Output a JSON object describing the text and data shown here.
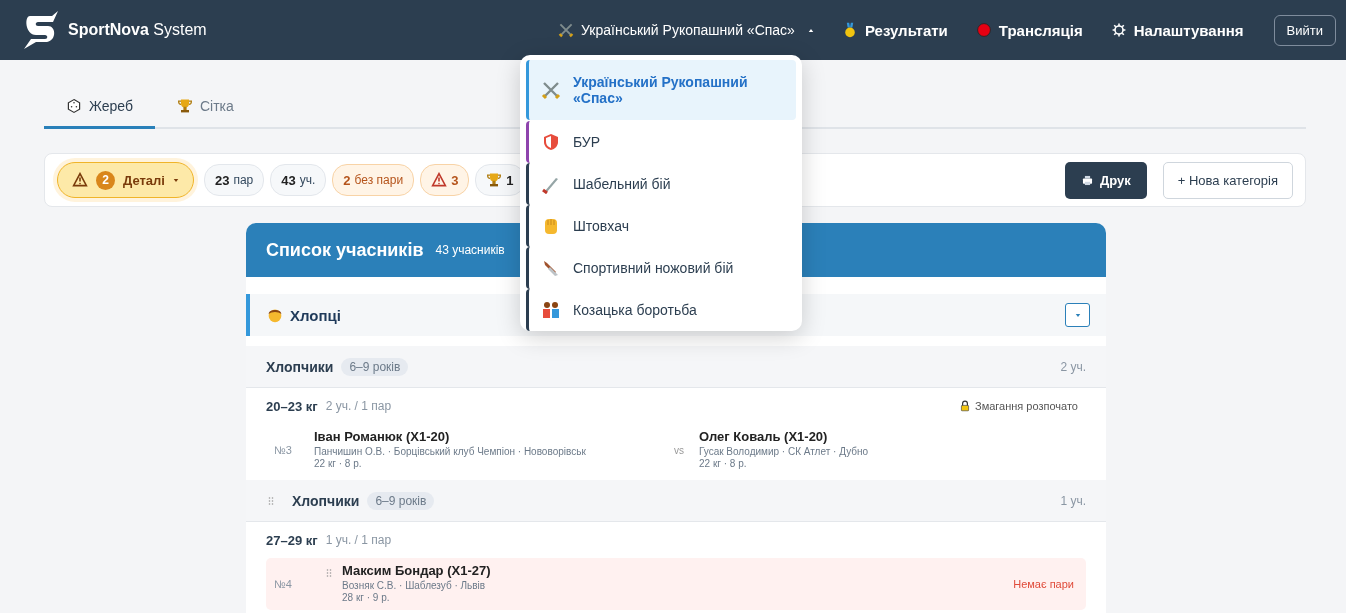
{
  "header": {
    "logo_text": "SportNova",
    "logo_sub": "System",
    "discipline": {
      "label": "Український Рукопашний «Спас»",
      "expanded": true
    },
    "nav": [
      {
        "kind": "medal",
        "label": "Результати"
      },
      {
        "kind": "live",
        "label": "Трансляція"
      },
      {
        "kind": "gear",
        "label": "Налаштування"
      }
    ],
    "logout": "Вийти"
  },
  "discipline_menu": [
    {
      "kind": "swords",
      "label": "Український Рукопашний «Спас»",
      "selected": true,
      "color": "#3498db"
    },
    {
      "kind": "shield",
      "label": "БУР",
      "selected": false,
      "color": "#8e44ad"
    },
    {
      "kind": "saber",
      "label": "Шабельний бій",
      "selected": false,
      "color": "#2c3e50"
    },
    {
      "kind": "fist",
      "label": "Штовхач",
      "selected": false,
      "color": "#2c3e50"
    },
    {
      "kind": "knife",
      "label": "Спортивний ножовий бій",
      "selected": false,
      "color": "#2c3e50"
    },
    {
      "kind": "wrestlers",
      "label": "Козацька боротьба",
      "selected": false,
      "color": "#2c3e50"
    }
  ],
  "tabs": [
    {
      "kind": "dice",
      "label": "Жереб",
      "selected": true
    },
    {
      "kind": "trophy",
      "label": "Сітка",
      "selected": false
    }
  ],
  "toolbar": {
    "details": {
      "count": "2",
      "label": "Деталі"
    },
    "chips": [
      {
        "kind": "plain",
        "value": "23",
        "label": "пар"
      },
      {
        "kind": "plain",
        "value": "43",
        "label": "уч."
      },
      {
        "kind": "orange",
        "value": "2",
        "label": "без пари"
      },
      {
        "kind": "warning",
        "value": "3"
      },
      {
        "kind": "trophy",
        "value": "1"
      }
    ],
    "print": "Друк",
    "new_category": "+ Нова категорія"
  },
  "list": {
    "title": "Список учасників",
    "subtitle": "43 учасників",
    "group": {
      "label": "Хлопці",
      "expanded": true
    },
    "sections": [
      {
        "title": "Хлопчики",
        "age": "6–9 років",
        "count": "2 уч.",
        "draggable": false,
        "weights": [
          {
            "weight": "20–23 кг",
            "meta": "2 уч. / 1 пар",
            "status": "Змагання розпочато",
            "pairs": [
              {
                "number": "№3",
                "unpaired": false,
                "draggable": false,
                "fighters": [
                  {
                    "name": "Іван Романюк (Х1-20)",
                    "info": "Панчишин О.В. · Борцівський клуб Чемпіон · Нововорівськ",
                    "stats": "22 кг · 8 р."
                  },
                  {
                    "name": "Олег Коваль (Х1-20)",
                    "info": "Гусак Володимир · СК Атлет · Дубно",
                    "stats": "22 кг · 8 р."
                  }
                ],
                "separator": "vs"
              }
            ]
          }
        ]
      },
      {
        "title": "Хлопчики",
        "age": "6–9 років",
        "count": "1 уч.",
        "draggable": true,
        "weights": [
          {
            "weight": "27–29 кг",
            "meta": "1 уч. / 1 пар",
            "pairs": [
              {
                "number": "№4",
                "unpaired": true,
                "draggable": true,
                "fighters": [
                  {
                    "name": "Максим Бондар (Х1-27)",
                    "info": "Возняк С.В. · Шаблезуб · Львів",
                    "stats": "28 кг · 9 р."
                  }
                ],
                "note": "Немає пари"
              }
            ]
          }
        ]
      }
    ]
  }
}
